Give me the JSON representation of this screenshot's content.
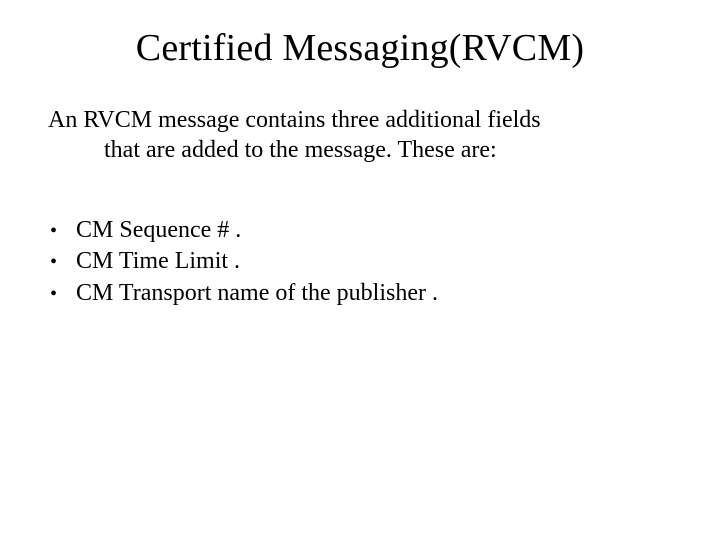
{
  "title": "Certified Messaging(RVCM)",
  "intro_line1": "An RVCM message contains three additional fields",
  "intro_line2": "that are added to the message. These are:",
  "bullets": [
    {
      "dot": "•",
      "text": "CM Sequence # ."
    },
    {
      "dot": "•",
      "text": "CM Time Limit ."
    },
    {
      "dot": "•",
      "text": "CM Transport name of the publisher ."
    }
  ]
}
